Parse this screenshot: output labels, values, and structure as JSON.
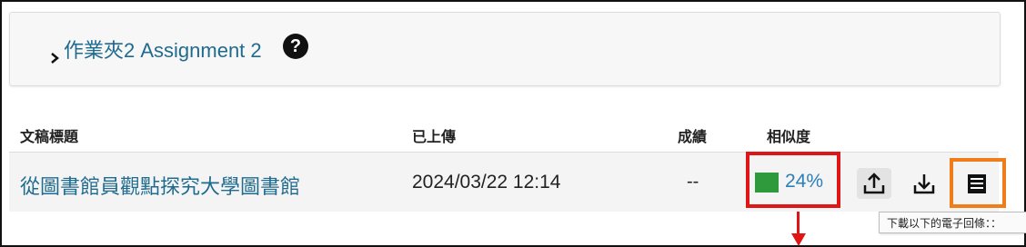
{
  "assignment": {
    "title": "作業夾2 Assignment 2",
    "help_symbol": "?"
  },
  "table": {
    "headers": {
      "title": "文稿標題",
      "uploaded": "已上傳",
      "grade": "成績",
      "similarity": "相似度"
    },
    "rows": [
      {
        "title": "從圖書館員觀點探究大學圖書館",
        "uploaded": "2024/03/22 12:14",
        "grade": "--",
        "similarity": "24%",
        "similarity_color": "#2e9a3b"
      }
    ]
  },
  "actions": {
    "icons": [
      "upload-icon",
      "download-icon",
      "receipt-icon"
    ]
  },
  "tooltip": {
    "text": "下載以下的電子回條：："
  },
  "colors": {
    "link": "#1f6b8f",
    "highlight_red": "#e01515",
    "highlight_orange": "#ef7d1a"
  }
}
